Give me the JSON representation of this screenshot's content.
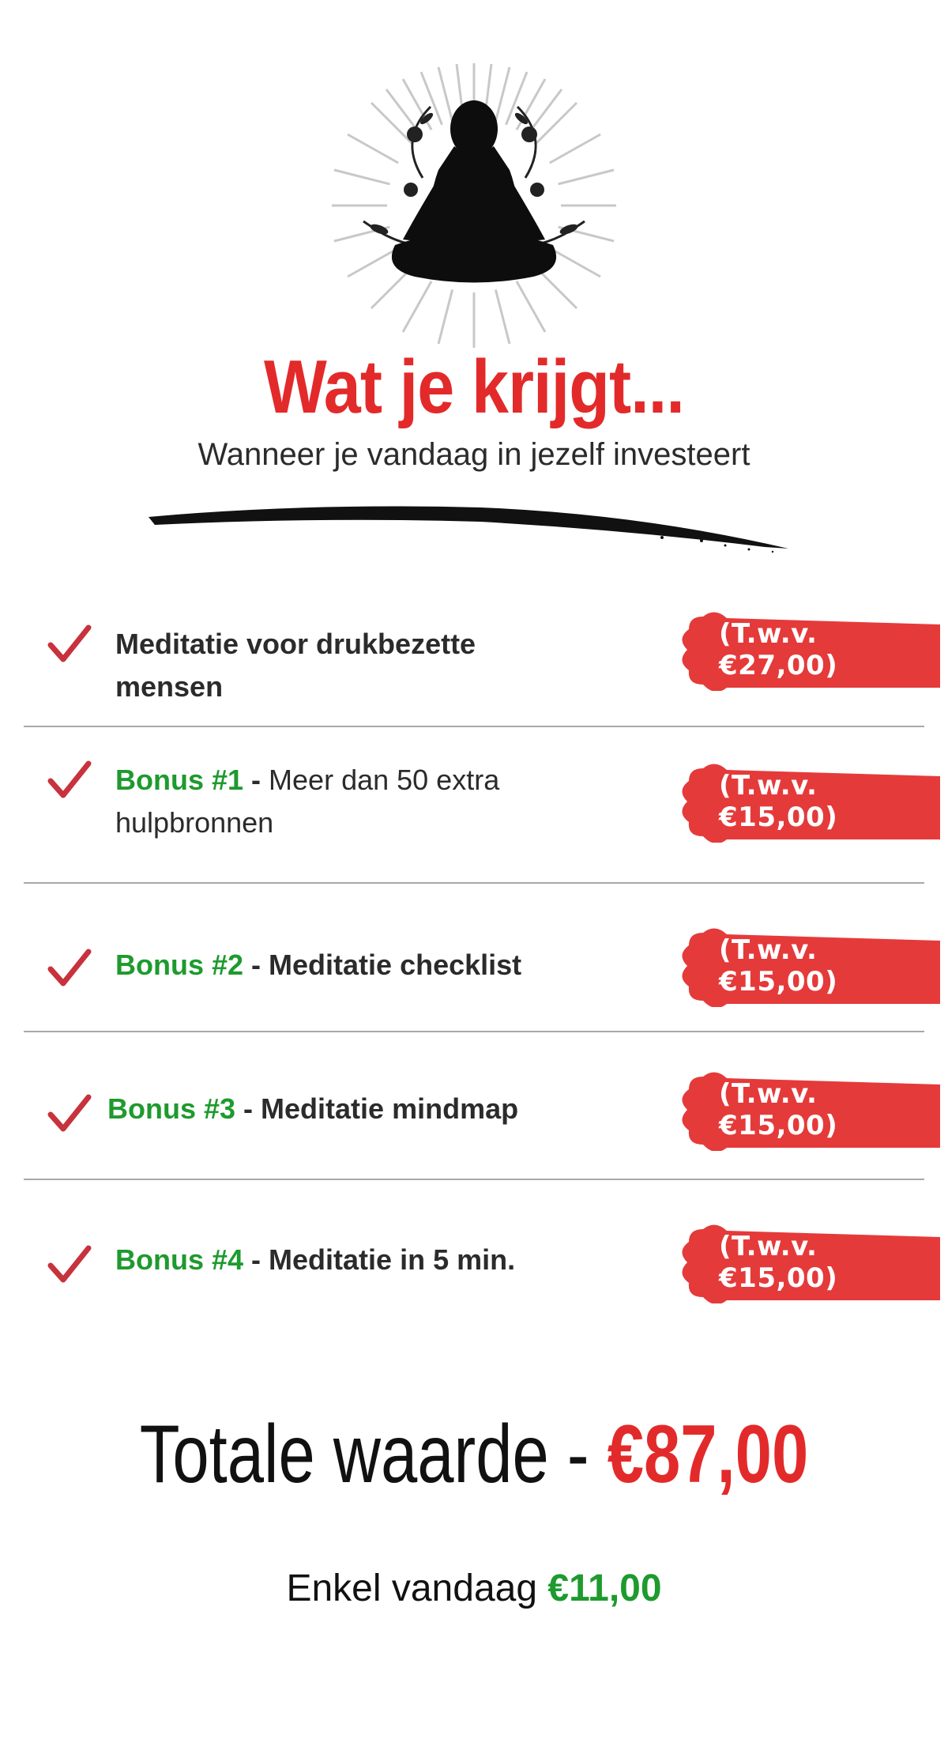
{
  "hero": {
    "icon": "meditation-silhouette-icon"
  },
  "heading": {
    "title": "Wat je krijgt...",
    "subtitle": "Wanneer je vandaag in jezelf investeert"
  },
  "items": [
    {
      "bonus": "",
      "separator": "",
      "text": "Meditatie voor drukbezette mensen",
      "price": "(T.w.v. €27,00)"
    },
    {
      "bonus": "Bonus #1",
      "separator": " - ",
      "text": "Meer dan 50 extra hulpbronnen",
      "price": "(T.w.v. €15,00)"
    },
    {
      "bonus": "Bonus #2",
      "separator": " - ",
      "text": "Meditatie checklist",
      "price": "(T.w.v. €15,00)"
    },
    {
      "bonus": "Bonus #3",
      "separator": " - ",
      "text": "Meditatie mindmap",
      "price": "(T.w.v. €15,00)"
    },
    {
      "bonus": "Bonus #4",
      "separator": " - ",
      "text": "Meditatie in 5 min.",
      "price": "(T.w.v. €15,00)"
    }
  ],
  "total": {
    "label": "Totale waarde - ",
    "amount": "€87,00"
  },
  "today": {
    "label": "Enkel vandaag ",
    "amount": "€11,00"
  },
  "colors": {
    "accent_red": "#e32a2a",
    "bonus_green": "#1e9a2e",
    "text": "#2b2b2b"
  }
}
